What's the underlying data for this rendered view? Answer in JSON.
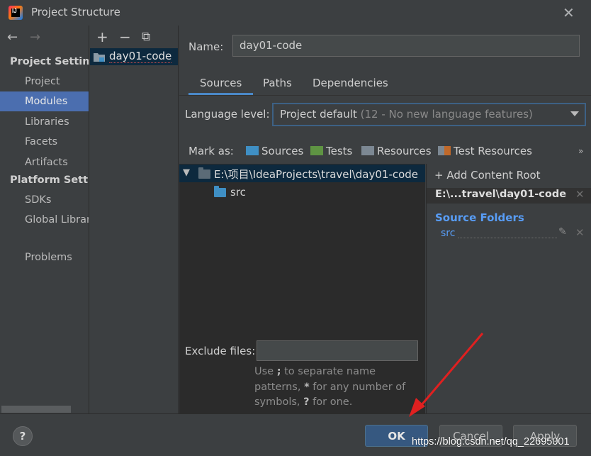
{
  "window": {
    "title": "Project Structure"
  },
  "nav": {
    "back": "←",
    "forward": "→",
    "sections": [
      {
        "heading": "Project Settings",
        "items": [
          "Project",
          "Modules",
          "Libraries",
          "Facets",
          "Artifacts"
        ]
      },
      {
        "heading": "Platform Settings",
        "items": [
          "SDKs",
          "Global Libraries"
        ]
      }
    ],
    "problems": "Problems",
    "selected": "Modules"
  },
  "modules": {
    "add": "+",
    "remove": "−",
    "copy": "⧉",
    "items": [
      "day01-code"
    ]
  },
  "main": {
    "name_label": "Name:",
    "name_value": "day01-code",
    "tabs": [
      "Sources",
      "Paths",
      "Dependencies"
    ],
    "selected_tab": "Sources",
    "language_label": "Language level:",
    "language_value": "Project default",
    "language_detail": "(12 - No new language features)",
    "mark_as_label": "Mark as:",
    "mark_as": [
      "Sources",
      "Tests",
      "Resources",
      "Test Resources"
    ],
    "mark_more": "»",
    "tree_root": "E:\\项目\\IdeaProjects\\travel\\day01-code",
    "tree_child": "src",
    "exclude_label": "Exclude files:",
    "exclude_value": "",
    "exclude_hint_parts": [
      "Use ",
      ";",
      " to separate name patterns, ",
      "*",
      " for any number of symbols, ",
      "?",
      " for one."
    ]
  },
  "content_root": {
    "add_label": "+ Add Content Root",
    "path": "E:\\...travel\\day01-code",
    "source_folders_heading": "Source Folders",
    "source_folder": "src"
  },
  "footer": {
    "help": "?",
    "ok": "OK",
    "cancel": "Cancel",
    "apply": "Apply",
    "watermark": "https://blog.csdn.net/qq_22695001"
  },
  "colors": {
    "selection": "#4b6eaf",
    "tree_selection": "#0d293e",
    "link_blue": "#589df6",
    "annotation_arrow": "#e02020"
  }
}
